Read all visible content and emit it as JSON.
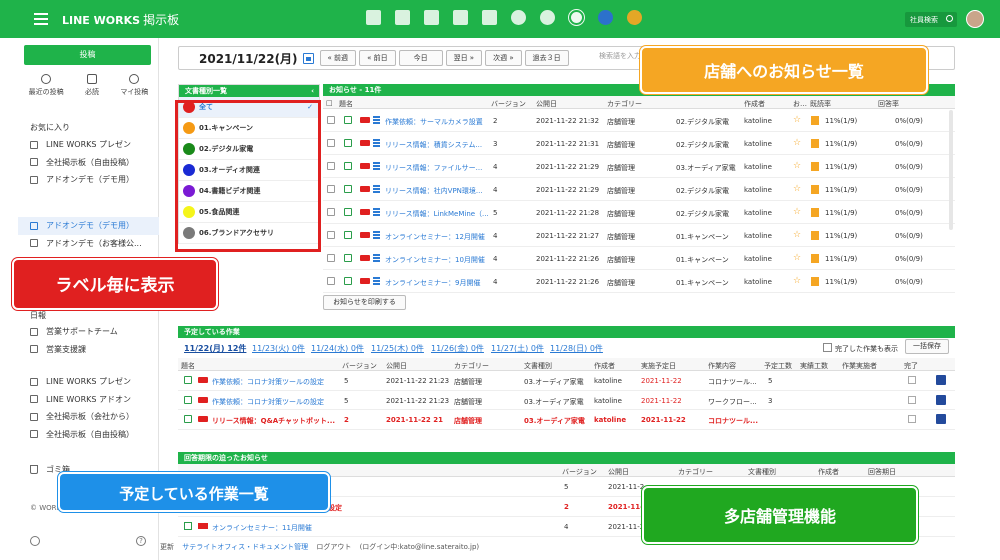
{
  "header": {
    "brand": "LINE WORKS",
    "app": "掲示板",
    "employee_search": "社員検索",
    "icons": [
      "memo-icon",
      "chat-icon",
      "mail-icon",
      "calendar-icon",
      "contacts-icon",
      "cloud-icon",
      "check-icon",
      "s-app-icon",
      "n-app-icon",
      "clock-app-icon"
    ]
  },
  "sidebar": {
    "post_button": "投稿",
    "quick": [
      {
        "label": "最近の投稿",
        "icon": "clock-icon"
      },
      {
        "label": "必読",
        "icon": "check-icon"
      },
      {
        "label": "マイ投稿",
        "icon": "chat-icon"
      }
    ],
    "favorites_title": "お気に入り",
    "favorites": [
      "LINE WORKS プレゼン",
      "全社掲示板（自由投稿）",
      "アドオンデモ（デモ用）"
    ],
    "group2": [
      "アドオンデモ（デモ用）",
      "アドオンデモ（お客様公..."
    ],
    "group3_title": "日報",
    "group3": [
      "営業サポートチーム",
      "営業支援課"
    ],
    "group4": [
      "LINE WORKS プレゼン",
      "LINE WORKS アドオン",
      "全社掲示板（会社から）",
      "全社掲示板（自由投稿）"
    ],
    "trash": "ゴミ箱",
    "copyright": "© WORKS"
  },
  "datebar": {
    "date": "2021/11/22(月)",
    "buttons": [
      "« 前週",
      "« 前日",
      "今日",
      "翌日 »",
      "次週 »",
      "過去３日"
    ],
    "search_placeholder": "検索語を入力し"
  },
  "categories": {
    "title": "文書種別一覧",
    "items": [
      {
        "label": "全て",
        "color": "#e02020"
      },
      {
        "label": "01.キャンペーン",
        "color": "#f59a14"
      },
      {
        "label": "02.デジタル家電",
        "color": "#1a8a1a"
      },
      {
        "label": "03.オーディオ関連",
        "color": "#1a2ad4"
      },
      {
        "label": "04.書籍ビデオ関連",
        "color": "#7a1ad4"
      },
      {
        "label": "05.食品関連",
        "color": "#f5f51a"
      },
      {
        "label": "06.ブランドアクセサリ",
        "color": "#7a7a7a"
      }
    ]
  },
  "notice": {
    "title": "お知らせ - 11件",
    "columns": [
      "題名",
      "バージョン",
      "公開日",
      "カテゴリー",
      "",
      "作成者",
      "お…",
      "既読率",
      "回答率"
    ],
    "rows": [
      {
        "title": "作業依頼：サーマルカメラ設置",
        "version": "2",
        "date": "2021-11-22 21:32",
        "category": "店舗管理",
        "doc": "02.デジタル家電",
        "author": "katoline",
        "read": "11%(1/9)",
        "answer": "0%(0/9)"
      },
      {
        "title": "リリース情報：積貨システム...",
        "version": "3",
        "date": "2021-11-22 21:31",
        "category": "店舗管理",
        "doc": "02.デジタル家電",
        "author": "katoline",
        "read": "11%(1/9)",
        "answer": "0%(0/9)"
      },
      {
        "title": "リリース情報：ファイルサー...",
        "version": "4",
        "date": "2021-11-22 21:29",
        "category": "店舗管理",
        "doc": "03.オーディア家電",
        "author": "katoline",
        "read": "11%(1/9)",
        "answer": "0%(0/9)"
      },
      {
        "title": "リリース情報：社内VPN環境...",
        "version": "4",
        "date": "2021-11-22 21:29",
        "category": "店舗管理",
        "doc": "02.デジタル家電",
        "author": "katoline",
        "read": "11%(1/9)",
        "answer": "0%(0/9)"
      },
      {
        "title": "リリース情報：LinkMeMine（...",
        "version": "5",
        "date": "2021-11-22 21:28",
        "category": "店舗管理",
        "doc": "02.デジタル家電",
        "author": "katoline",
        "read": "11%(1/9)",
        "answer": "0%(0/9)"
      },
      {
        "title": "オンラインセミナー：12月開催",
        "version": "4",
        "date": "2021-11-22 21:27",
        "category": "店舗管理",
        "doc": "01.キャンペーン",
        "author": "katoline",
        "read": "11%(1/9)",
        "answer": "0%(0/9)"
      },
      {
        "title": "オンラインセミナー：10月開催",
        "version": "4",
        "date": "2021-11-22 21:26",
        "category": "店舗管理",
        "doc": "01.キャンペーン",
        "author": "katoline",
        "read": "11%(1/9)",
        "answer": "0%(0/9)"
      },
      {
        "title": "オンラインセミナー：9月開催",
        "version": "4",
        "date": "2021-11-22 21:26",
        "category": "店舗管理",
        "doc": "01.キャンペーン",
        "author": "katoline",
        "read": "11%(1/9)",
        "answer": "0%(0/9)"
      }
    ],
    "print_button": "お知らせを印刷する"
  },
  "sched": {
    "title": "予定している作業",
    "days": [
      "11/22(月) 12件",
      "11/23(火) 0件",
      "11/24(水) 0件",
      "11/25(木) 0件",
      "11/26(金) 0件",
      "11/27(土) 0件",
      "11/28(日) 0件"
    ],
    "show_all": "完了した作業も表示",
    "save_button": "一括保存",
    "columns": [
      "題名",
      "バージョン",
      "公開日",
      "カテゴリー",
      "文書種別",
      "作成者",
      "実施予定日",
      "作業内容",
      "予定工数",
      "実績工数",
      "作業実施者",
      "完了"
    ],
    "rows": [
      {
        "title": "作業依頼：コロナ対策ツールの設定",
        "version": "5",
        "date": "2021-11-22 21:23",
        "category": "店舗管理",
        "doc": "03.オーディア家電",
        "author": "katoline",
        "planned": "2021-11-22",
        "work": "コロナツール...",
        "hours": "5",
        "red": false
      },
      {
        "title": "作業依頼：コロナ対策ツールの設定",
        "version": "5",
        "date": "2021-11-22 21:23",
        "category": "店舗管理",
        "doc": "03.オーディア家電",
        "author": "katoline",
        "planned": "2021-11-22",
        "work": "ワークフロー...",
        "hours": "3",
        "red": false
      },
      {
        "title": "リリース情報：Q&Aチャットボット...",
        "version": "2",
        "date": "2021-11-22 21",
        "category": "店舗管理",
        "doc": "03.オーディア家電",
        "author": "katoline",
        "planned": "2021-11-22",
        "work": "コロナツール...",
        "hours": "",
        "red": true
      }
    ]
  },
  "deadline": {
    "title": "回答期限の迫ったお知らせ",
    "columns": [
      "バージョン",
      "公開日",
      "カテゴリー",
      "文書種別",
      "作成者",
      "回答期日"
    ],
    "rows": [
      {
        "title": "",
        "version": "5",
        "date": "2021-11-2",
        "red": false
      },
      {
        "title": "設定",
        "version": "2",
        "date": "2021-11-2",
        "red": true
      },
      {
        "title": "オンラインセミナー：11月開催",
        "version": "4",
        "date": "2021-11-2",
        "red": false
      }
    ]
  },
  "footer": [
    "更新",
    "サテライトオフィス・ドキュメント管理",
    "ログアウト",
    "(ログイン中:kato@line.sateraito.jp)"
  ],
  "callouts": {
    "orange": "店舗へのお知らせ一覧",
    "red": "ラベル毎に表示",
    "blue": "予定している作業一覧",
    "green": "多店舗管理機能"
  }
}
